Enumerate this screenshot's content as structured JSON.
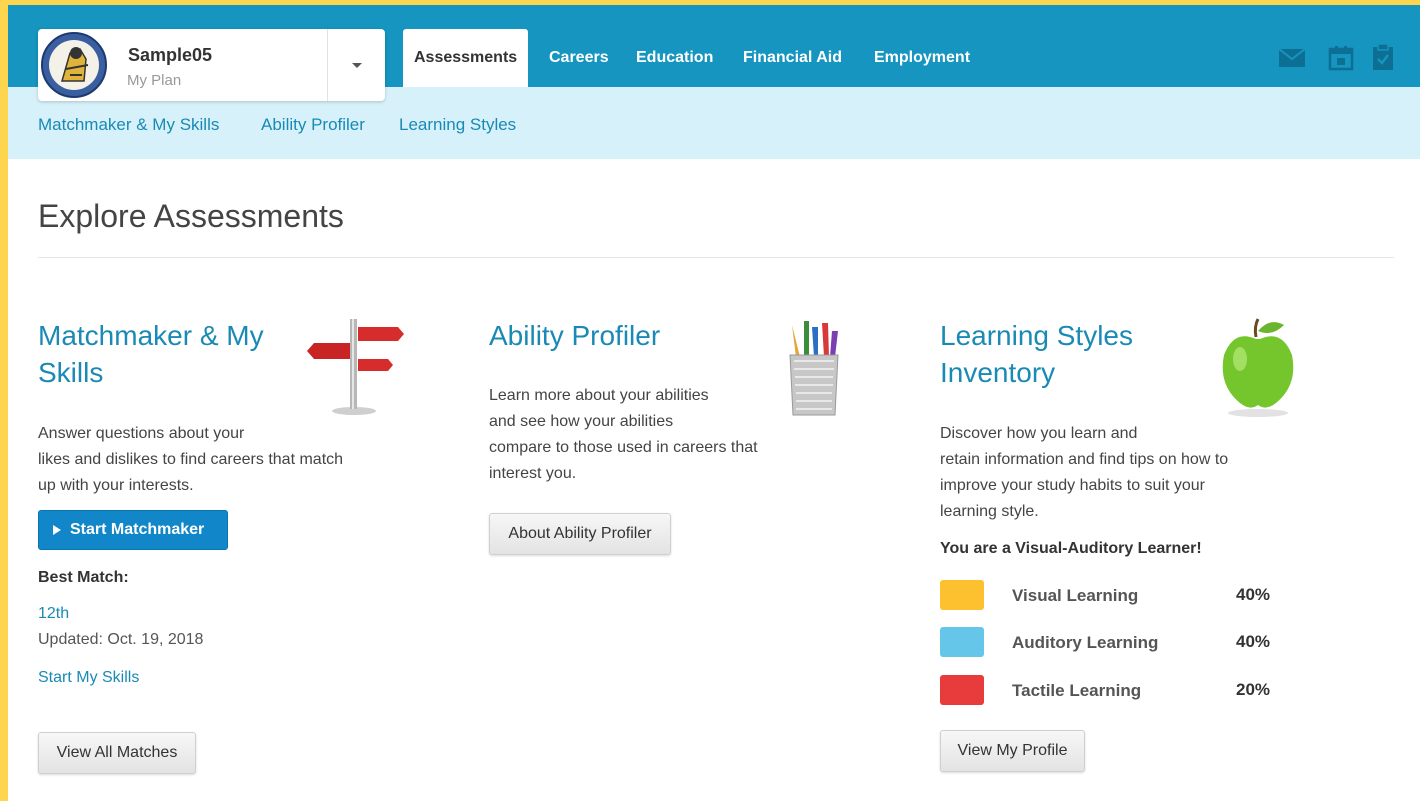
{
  "header": {
    "plan_name": "Sample05",
    "plan_subtitle": "My Plan",
    "tabs": [
      {
        "label": "Assessments",
        "active": true
      },
      {
        "label": "Careers"
      },
      {
        "label": "Education"
      },
      {
        "label": "Financial Aid"
      },
      {
        "label": "Employment"
      }
    ],
    "icons": [
      "mail-icon",
      "calendar-icon",
      "clipboard-icon"
    ]
  },
  "subnav": {
    "links": [
      "Matchmaker & My Skills",
      "Ability Profiler",
      "Learning Styles"
    ]
  },
  "page": {
    "title": "Explore Assessments"
  },
  "matchmaker": {
    "title_line1": "Matchmaker & My",
    "title_line2": "Skills",
    "desc_line1": "Answer questions about your",
    "desc_line2": "likes and dislikes to find careers that match",
    "desc_line3": "up with your interests.",
    "start_button": "Start Matchmaker",
    "best_match_label": "Best Match:",
    "best_match_value": "12th",
    "updated": "Updated: Oct. 19, 2018",
    "start_skills_link": "Start My Skills",
    "view_all_button": "View All Matches"
  },
  "ability": {
    "title": "Ability Profiler",
    "desc_line1": "Learn more about your abilities",
    "desc_line2": "and see how your abilities",
    "desc_line3": "compare to those used in careers that",
    "desc_line4": "interest you.",
    "about_button": "About Ability Profiler"
  },
  "learning": {
    "title_line1": "Learning Styles",
    "title_line2": "Inventory",
    "desc_line1": "Discover how you learn and",
    "desc_line2": "retain information and find tips on how to",
    "desc_line3": "improve your study habits to suit your",
    "desc_line4": "learning style.",
    "result": "You are a Visual-Auditory Learner!",
    "styles": [
      {
        "name": "Visual Learning",
        "percent": "40%",
        "color": "#fdc02f"
      },
      {
        "name": "Auditory Learning",
        "percent": "40%",
        "color": "#65c6e9"
      },
      {
        "name": "Tactile Learning",
        "percent": "20%",
        "color": "#e83b3b"
      }
    ],
    "profile_button": "View My Profile"
  },
  "colors": {
    "topbar": "#1595bf",
    "subbar": "#d6f1f9",
    "accent_link": "#1a8ab5",
    "primary_button": "#1187c9",
    "outer_border": "#fdd54f"
  }
}
